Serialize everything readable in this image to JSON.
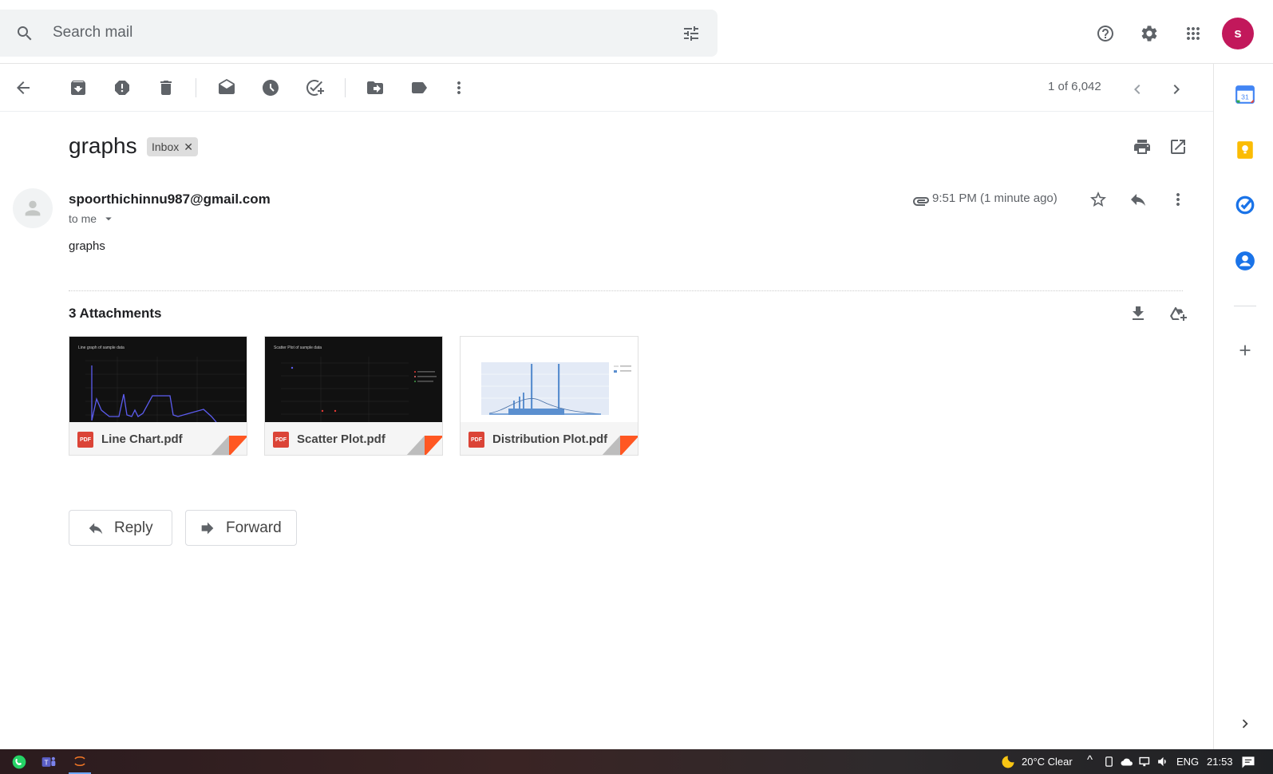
{
  "search": {
    "placeholder": "Search mail"
  },
  "account": {
    "initial": "s",
    "color": "#c2185b"
  },
  "toolbar": {
    "count": "1 of 6,042"
  },
  "message": {
    "subject": "graphs",
    "label": "Inbox",
    "sender": "spoorthichinnu987@gmail.com",
    "to": "to me",
    "time": "9:51 PM (1 minute ago)",
    "body": "graphs"
  },
  "attachments": {
    "title": "3 Attachments",
    "items": [
      {
        "name": "Line Chart.pdf",
        "badge": "PDF",
        "thumb_title": "Line graph of sample data"
      },
      {
        "name": "Scatter Plot.pdf",
        "badge": "PDF",
        "thumb_title": "Scatter Plot of sample data"
      },
      {
        "name": "Distribution Plot.pdf",
        "badge": "PDF",
        "thumb_title": ""
      }
    ]
  },
  "actions": {
    "reply": "Reply",
    "forward": "Forward"
  },
  "taskbar": {
    "weather": "20°C  Clear",
    "lang": "ENG",
    "clock": "21:53"
  },
  "colors": {
    "accent": "#1a73e8",
    "pdf": "#db4437"
  }
}
